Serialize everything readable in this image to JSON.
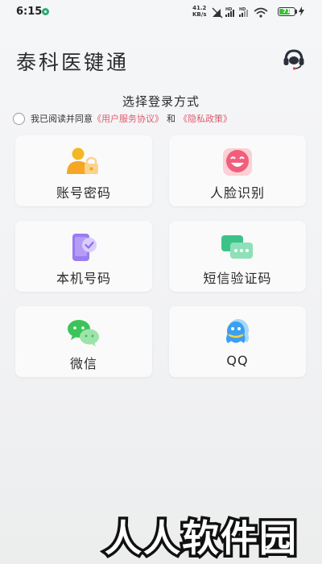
{
  "status_bar": {
    "time": "6:15",
    "net_speed_value": "41.2",
    "net_speed_unit": "KB/s",
    "battery_level": "71",
    "battery_fraction": 0.71
  },
  "header": {
    "title": "泰科医键通",
    "service_icon": "headset-service-icon"
  },
  "login": {
    "section_title": "选择登录方式",
    "agreement": {
      "prefix": "我已阅读并同意",
      "user_agreement": "《用户服务协议》",
      "and": "和",
      "privacy_policy": "《隐私政策》"
    },
    "methods": [
      {
        "label": "账号密码",
        "icon": "account-password-icon"
      },
      {
        "label": "人脸识别",
        "icon": "face-recognition-icon"
      },
      {
        "label": "本机号码",
        "icon": "local-phone-icon"
      },
      {
        "label": "短信验证码",
        "icon": "sms-code-icon"
      },
      {
        "label": "微信",
        "icon": "wechat-icon"
      },
      {
        "label": "QQ",
        "icon": "qq-icon"
      }
    ]
  },
  "watermark": {
    "text": "人人软件园"
  },
  "colors": {
    "background": "#f3f4f6",
    "card": "#fafafb",
    "link": "#e05b6d",
    "wechat_green": "#3cc45a",
    "qq_blue": "#3aa0f0"
  }
}
